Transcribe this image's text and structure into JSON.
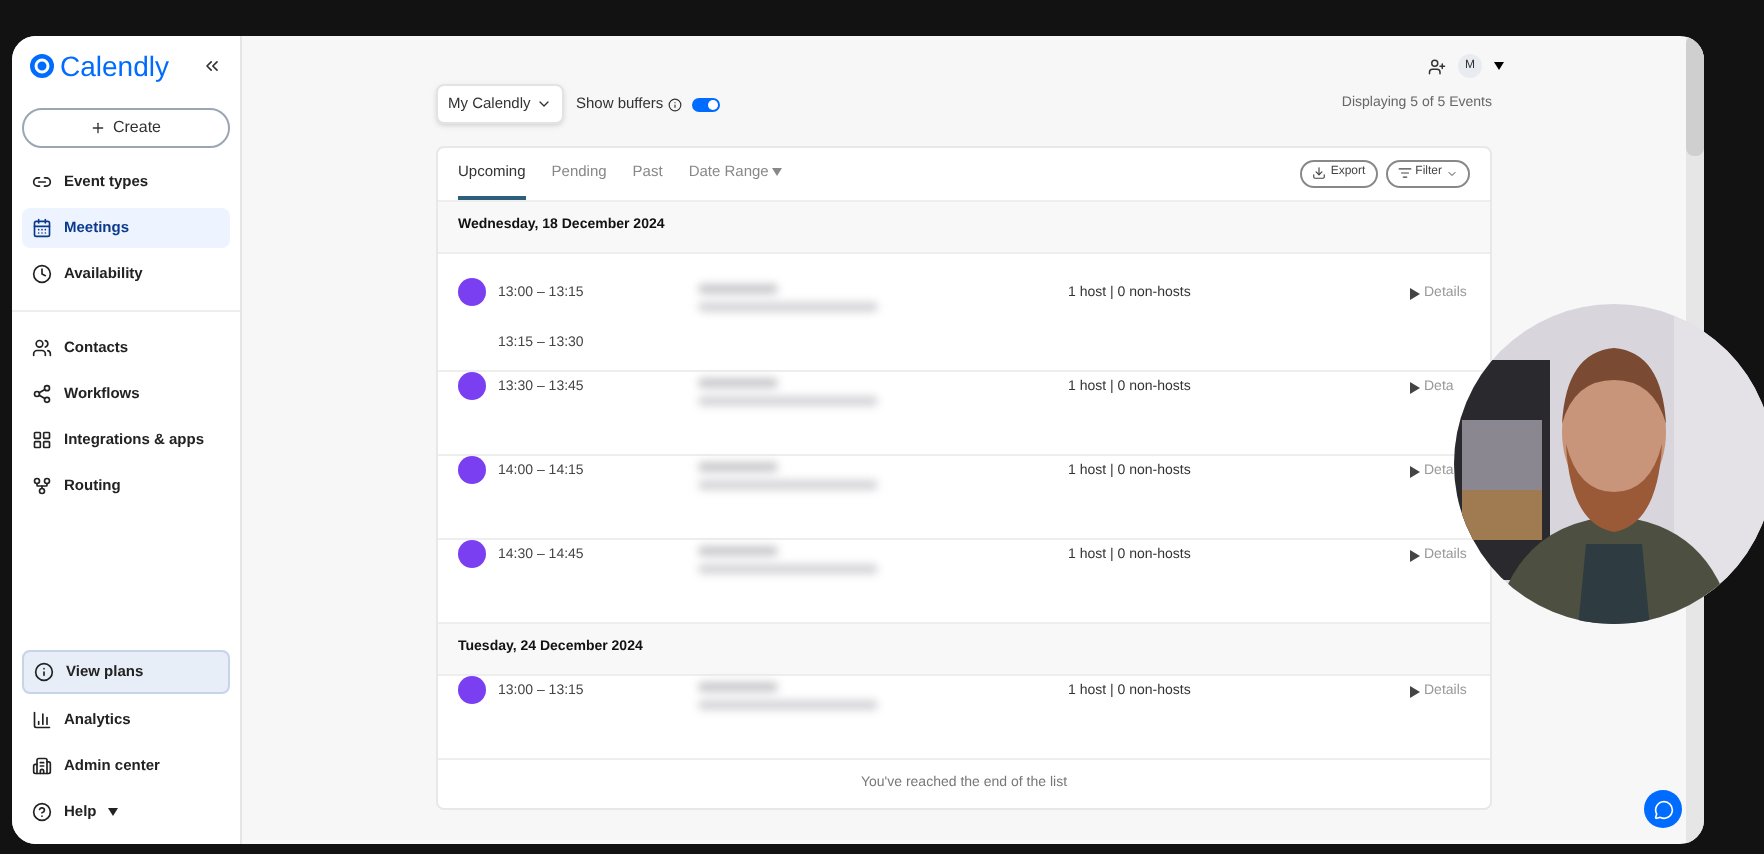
{
  "logo": "Calendly",
  "sidebar": {
    "create_button": "Create",
    "nav": [
      {
        "label": "Event types",
        "selected": false,
        "kind": "event-types"
      },
      {
        "label": "Meetings",
        "selected": true,
        "kind": "meetings"
      },
      {
        "label": "Availability",
        "selected": false,
        "kind": "availability"
      },
      {
        "label": "Contacts",
        "selected": false,
        "kind": "contacts"
      },
      {
        "label": "Workflows",
        "selected": false,
        "kind": "workflows"
      },
      {
        "label": "Integrations & apps",
        "selected": false,
        "kind": "integrations"
      },
      {
        "label": "Routing",
        "selected": false,
        "kind": "routing"
      }
    ],
    "bottom": [
      {
        "label": "View plans",
        "kind": "plans"
      },
      {
        "label": "Analytics",
        "kind": "analytics"
      },
      {
        "label": "Admin center",
        "kind": "admin"
      },
      {
        "label": "Help",
        "kind": "help"
      }
    ]
  },
  "header": {
    "avatar": "M"
  },
  "toolbar": {
    "calendar_select": "My Calendly",
    "buffers_label": "Show buffers",
    "buffers_on": true,
    "summary": "Displaying 5 of 5 Events"
  },
  "tabs": [
    {
      "label": "Upcoming",
      "selected": true,
      "kind": "tab"
    },
    {
      "label": "Pending",
      "selected": false,
      "kind": "tab"
    },
    {
      "label": "Past",
      "selected": false,
      "kind": "tab"
    },
    {
      "label": "Date Range",
      "selected": false,
      "kind": "dropdown"
    }
  ],
  "actions": [
    {
      "label": "Export",
      "kind": "export"
    },
    {
      "label": "Filter",
      "kind": "filter"
    }
  ],
  "days": [
    {
      "date": "Wednesday, 18 December 2024",
      "events": [
        {
          "times": [
            "13:00 – 13:15",
            "13:15 – 13:30"
          ],
          "attendees": "1 host | 0 non-hosts",
          "details": "Details"
        },
        {
          "times": [
            "13:30 – 13:45"
          ],
          "attendees": "1 host | 0 non-hosts",
          "details": "Deta"
        },
        {
          "times": [
            "14:00 – 14:15"
          ],
          "attendees": "1 host | 0 non-hosts",
          "details": "Deta"
        },
        {
          "times": [
            "14:30 – 14:45"
          ],
          "attendees": "1 host | 0 non-hosts",
          "details": "Details"
        }
      ]
    },
    {
      "date": "Tuesday, 24 December 2024",
      "events": [
        {
          "times": [
            "13:00 – 13:15"
          ],
          "attendees": "1 host | 0 non-hosts",
          "details": "Details"
        }
      ]
    }
  ],
  "footer": "You've reached the end of the list"
}
